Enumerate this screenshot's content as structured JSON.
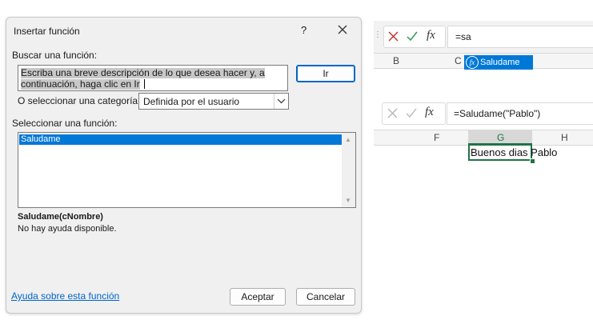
{
  "dialog": {
    "title": "Insertar función",
    "help_label": "?",
    "search_label": "Buscar una función:",
    "search_line1": "Escriba una breve descripción de lo que desea hacer y, a",
    "search_line2": "continuación, haga clic en Ir",
    "go_button": "Ir",
    "category_label": "O seleccionar una categoría:",
    "category_value": "Definida por el usuario",
    "function_label": "Seleccionar una función:",
    "functions": [
      "Saludame"
    ],
    "selected_function": "Saludame",
    "signature": "Saludame(cNombre)",
    "description": "No hay ayuda disponible.",
    "help_link": "Ayuda sobre esta función",
    "ok_button": "Aceptar",
    "cancel_button": "Cancelar"
  },
  "excel_top": {
    "fx_label": "fx",
    "formula": "=sa",
    "col_b": "B",
    "col_c": "C",
    "autocomplete_item": "Saludame"
  },
  "excel_bottom": {
    "fx_label": "fx",
    "formula": "=Saludame(\"Pablo\")",
    "col_f": "F",
    "col_g": "G",
    "col_h": "H",
    "cell_value": "Buenos dias Pablo"
  },
  "colors": {
    "accent": "#0078d7",
    "excel_green": "#217346",
    "cancel_red": "#c0392b",
    "confirm_green": "#2e9b4f",
    "link": "#0066cc"
  },
  "icons": [
    "close-icon",
    "chevron-down-icon",
    "scroll-up-icon",
    "scroll-down-icon",
    "cancel-x-icon",
    "check-icon",
    "function-icon"
  ]
}
